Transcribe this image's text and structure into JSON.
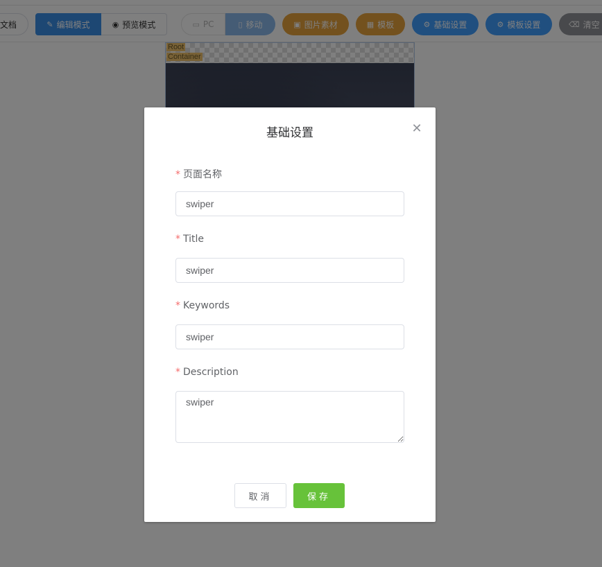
{
  "toolbar": {
    "docs_label": "文档",
    "edit_mode_label": "编辑模式",
    "preview_mode_label": "预览模式",
    "pc_label": "PC",
    "mobile_label": "移动",
    "images_label": "图片素材",
    "template_label": "模板",
    "basic_settings_label": "基础设置",
    "template_settings_label": "模板设置",
    "clear_label": "清空",
    "icons": {
      "edit": "pencil-icon",
      "preview": "eye-icon",
      "pc": "monitor-icon",
      "mobile": "phone-icon",
      "images": "image-icon",
      "template": "grid-icon",
      "basic_settings": "gear-icon",
      "template_settings": "gear-icon",
      "clear": "eraser-icon"
    }
  },
  "canvas": {
    "root_tag": "Root",
    "container_tag": "Container"
  },
  "dialog": {
    "title": "基础设置",
    "fields": {
      "page_name": {
        "label": "页面名称",
        "value": "swiper"
      },
      "title": {
        "label": "Title",
        "value": "swiper"
      },
      "keywords": {
        "label": "Keywords",
        "value": "swiper"
      },
      "description": {
        "label": "Description",
        "value": "swiper"
      }
    },
    "required_mark": "*",
    "cancel_label": "取消",
    "save_label": "保存"
  },
  "colors": {
    "primary": "#409eff",
    "warning": "#e6a23c",
    "success": "#67c23a",
    "info": "#909399",
    "required": "#f56c6c"
  }
}
